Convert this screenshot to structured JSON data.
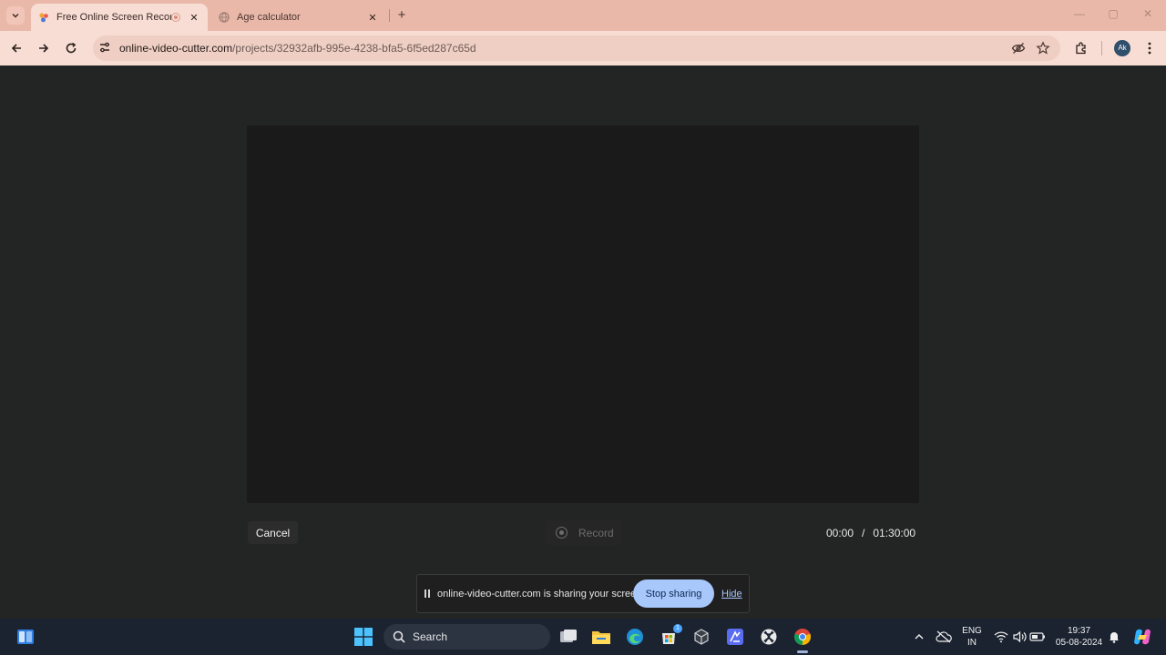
{
  "browser": {
    "tabs": [
      {
        "title": "Free Online Screen Recorde",
        "active": true
      },
      {
        "title": "Age calculator",
        "active": false
      }
    ],
    "url_host": "online-video-cutter.com",
    "url_path": "/projects/32932afb-995e-4238-bfa5-6f5ed287c65d",
    "profile_initials": "Ak"
  },
  "recorder": {
    "cancel_label": "Cancel",
    "record_label": "Record",
    "elapsed": "00:00",
    "separator": "/",
    "limit": "01:30:00"
  },
  "share_bar": {
    "message": "online-video-cutter.com is sharing your screen.",
    "stop_label": "Stop sharing",
    "hide_label": "Hide"
  },
  "taskbar": {
    "search_label": "Search",
    "language_line1": "ENG",
    "language_line2": "IN",
    "time": "19:37",
    "date": "05-08-2024",
    "store_badge": "1"
  },
  "colors": {
    "titlebar": "#e9b8a9",
    "toolbar": "#f7ddd4",
    "page_bg": "#232424",
    "preview_bg": "#1a1a1a",
    "stop_button": "#a8c7fa",
    "taskbar": "#1b2331"
  }
}
